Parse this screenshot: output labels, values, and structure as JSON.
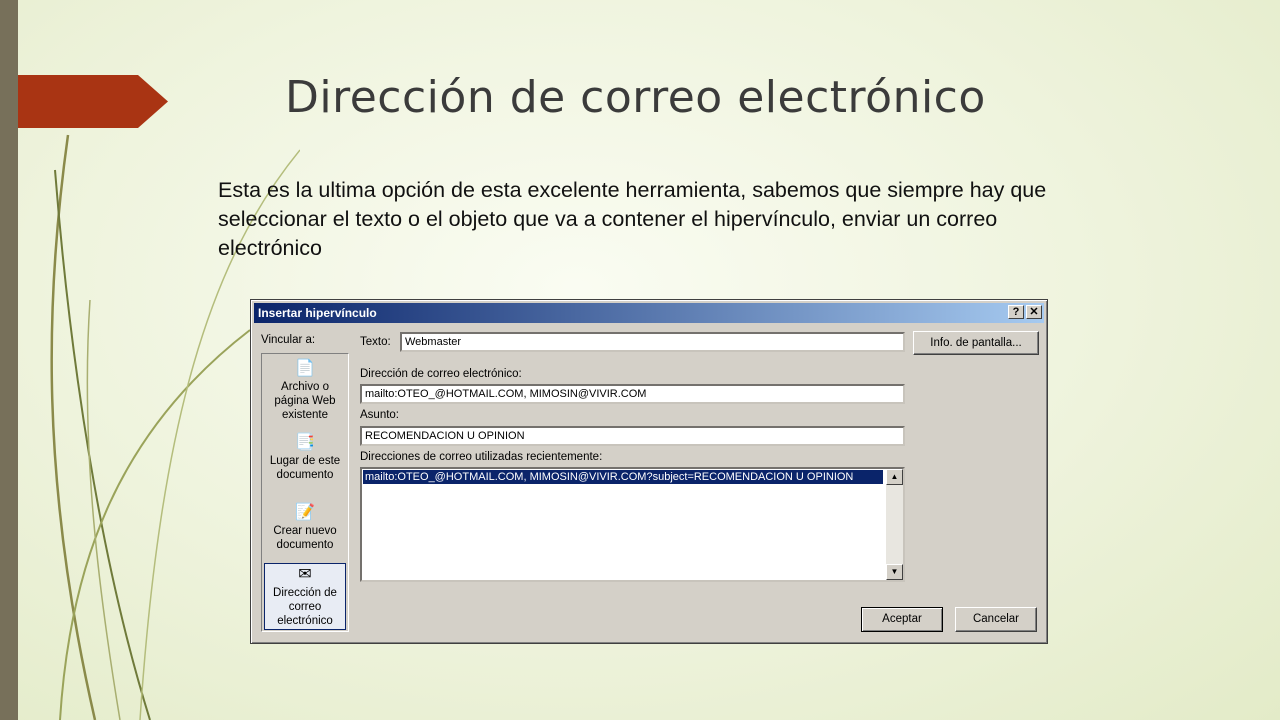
{
  "slide": {
    "title": "Dirección de correo electrónico",
    "body": "Esta es la ultima opción de esta excelente herramienta, sabemos que siempre hay que seleccionar el texto o el objeto que va a contener el hipervínculo, enviar un correo electrónico"
  },
  "colors": {
    "accent": "#a93413",
    "left_bar": "#77705a",
    "dialog_title": "#0a246a"
  },
  "dialog": {
    "title": "Insertar hipervínculo",
    "help_label": "?",
    "close_label": "✕",
    "link_to_label": "Vincular a:",
    "link_items": [
      {
        "label": "Archivo o página Web existente",
        "icon": "web-page-icon"
      },
      {
        "label": "Lugar de este documento",
        "icon": "document-place-icon"
      },
      {
        "label": "Crear nuevo documento",
        "icon": "new-document-icon"
      },
      {
        "label": "Dirección de correo electrónico",
        "icon": "email-icon"
      }
    ],
    "text_label": "Texto:",
    "text_value": "Webmaster",
    "screentip_label": "Info. de pantalla...",
    "email_label": "Dirección de correo electrónico:",
    "email_value": "mailto:OTEO_@HOTMAIL.COM, MIMOSIN@VIVIR.COM",
    "subject_label": "Asunto:",
    "subject_value": "RECOMENDACION U OPINION",
    "recent_label": "Direcciones de correo utilizadas recientemente:",
    "recent_items": [
      "mailto:OTEO_@HOTMAIL.COM, MIMOSIN@VIVIR.COM?subject=RECOMENDACION U OPINION"
    ],
    "ok_label": "Aceptar",
    "cancel_label": "Cancelar"
  }
}
